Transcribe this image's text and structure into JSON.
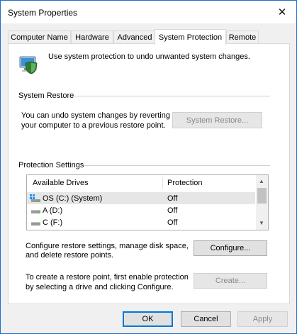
{
  "window": {
    "title": "System Properties"
  },
  "tabs": [
    {
      "label": "Computer Name"
    },
    {
      "label": "Hardware"
    },
    {
      "label": "Advanced"
    },
    {
      "label": "System Protection"
    },
    {
      "label": "Remote"
    }
  ],
  "intro": {
    "text": "Use system protection to undo unwanted system changes."
  },
  "system_restore": {
    "heading": "System Restore",
    "line1": "You can undo system changes by reverting",
    "line2": "your computer to a previous restore point.",
    "button": "System Restore..."
  },
  "protection": {
    "heading": "Protection Settings",
    "columns": {
      "drives": "Available Drives",
      "protection": "Protection"
    },
    "rows": [
      {
        "drive": "OS (C:) (System)",
        "protection": "Off"
      },
      {
        "drive": "A (D:)",
        "protection": "Off"
      },
      {
        "drive": "C (F:)",
        "protection": "Off"
      }
    ]
  },
  "configure": {
    "line1": "Configure restore settings, manage disk space,",
    "line2": "and delete restore points.",
    "button": "Configure..."
  },
  "create": {
    "line1": "To create a restore point, first enable protection",
    "line2": "by selecting a drive and clicking Configure.",
    "button": "Create..."
  },
  "footer": {
    "ok": "OK",
    "cancel": "Cancel",
    "apply": "Apply"
  }
}
